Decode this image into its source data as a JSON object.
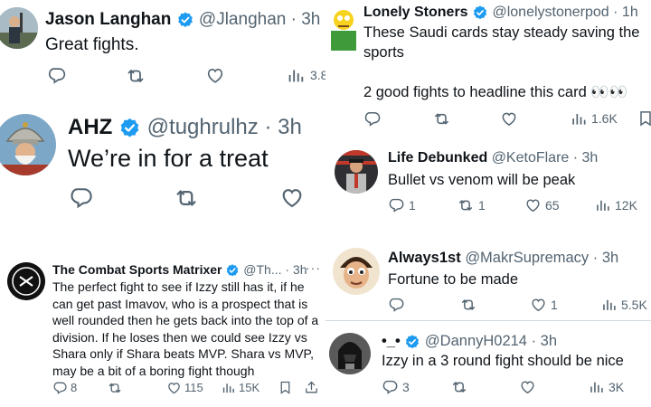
{
  "tweets": {
    "t1": {
      "name": "Jason Langhan",
      "handle": "@Jlanghan",
      "time": "· 3h",
      "text": "Great fights.",
      "views": "3.8"
    },
    "t2": {
      "name": "AHZ",
      "handle": "@tughrulhz",
      "time": "· 3h",
      "text": "We’re in for a treat"
    },
    "t3": {
      "name": "The Combat Sports Matrixer",
      "handle": "@Th...",
      "time": "· 3h",
      "text": "The perfect fight to see if Izzy still has it, if he can get past Imavov, who is a prospect that is well rounded then he gets back into the top of a division. If he loses then we could see Izzy vs Shara only if Shara beats MVP. Shara vs MVP, may be a bit of a boring fight though",
      "replies": "8",
      "likes": "115",
      "views": "15K",
      "more": "···"
    },
    "t4": {
      "name": "Lonely Stoners",
      "handle": "@lonelystonerpod",
      "time": "· 1h",
      "text": "These Saudi cards stay steady saving the sports\n\n2 good fights to headline this card 👀👀",
      "views": "1.6K"
    },
    "t5": {
      "name": "Life Debunked",
      "handle": "@KetoFlare",
      "time": "· 3h",
      "text": "Bullet vs venom will be peak",
      "replies": "1",
      "reposts": "1",
      "likes": "65",
      "views": "12K"
    },
    "t6": {
      "name": "Always1st",
      "handle": "@MakrSupremacy",
      "time": "· 3h",
      "text": "Fortune to be made",
      "likes": "1",
      "views": "5.5K"
    },
    "t7": {
      "name": "•_•",
      "handle": "@DannyH0214",
      "time": "· 3h",
      "text": "Izzy in a 3 round fight should be nice",
      "replies": "3",
      "views": "3K"
    }
  },
  "colors": {
    "verified": "#1d9bf0",
    "secondary": "#536471",
    "text": "#0f1419",
    "divider": "#cfd9de"
  }
}
